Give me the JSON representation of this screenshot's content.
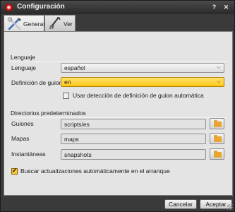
{
  "window": {
    "title": "Configuración"
  },
  "icons": {
    "app": "record-icon",
    "help": "help-icon",
    "close": "close-icon",
    "tab_general": "tools-icon",
    "tab_ver": "paintbrush-icon",
    "browse": "folder-icon",
    "combo_arrow": "chevron-down-icon"
  },
  "titlebar": {
    "help_glyph": "?",
    "close_glyph": "✕"
  },
  "tabs": [
    {
      "label": "General",
      "active": true
    },
    {
      "label": "Ver",
      "active": false
    }
  ],
  "language_group": {
    "title": "Lenguaje",
    "language": {
      "label": "Lenguaje",
      "value": "español"
    },
    "script_definition": {
      "label": "Definición de guion",
      "value": "en"
    },
    "auto_detect": {
      "label": "Usar detección de definición de guion automática",
      "checked": false
    }
  },
  "directories_group": {
    "title": "Directorios predeterminados",
    "scripts": {
      "label": "Guiones",
      "value": "scripts/es"
    },
    "maps": {
      "label": "Mapas",
      "value": "maps"
    },
    "snapshots": {
      "label": "Instantáneas",
      "value": "snapshots"
    }
  },
  "updates": {
    "label": "Buscar actualizaciones automáticamente en el arranque",
    "checked": true
  },
  "footer": {
    "cancel_label": "Cancelar",
    "accept_label": "Aceptar"
  },
  "colors": {
    "accent": "#ffc61a",
    "folder": "#e8a531",
    "close_red": "#d91a1a"
  }
}
